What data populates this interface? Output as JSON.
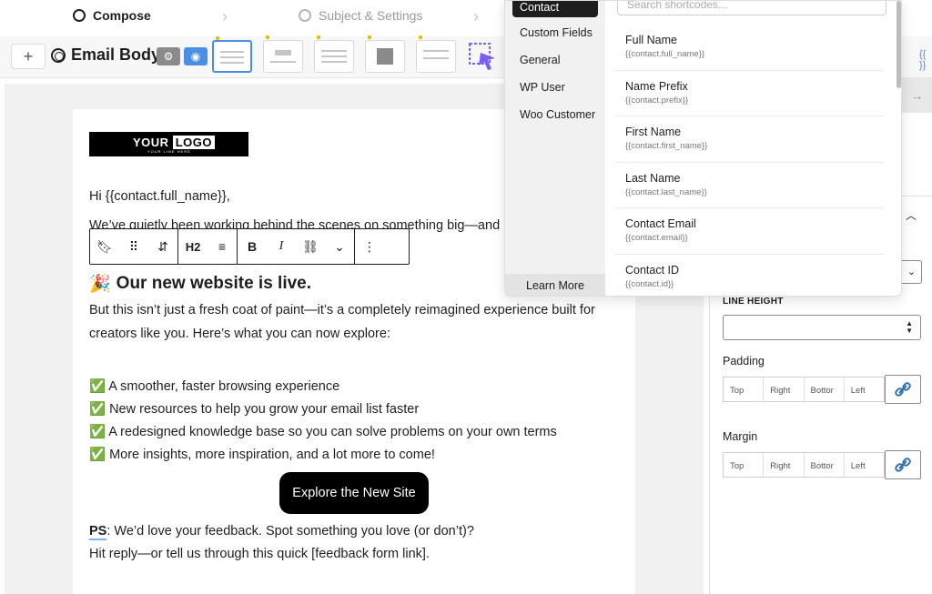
{
  "steps": [
    {
      "label": "Compose",
      "active": true
    },
    {
      "label": "Subject & Settings",
      "active": false
    }
  ],
  "toolbar": {
    "add_label": "+",
    "title": "Email Body"
  },
  "email": {
    "logo_text_1": "YOUR",
    "logo_text_2": "LOGO",
    "logo_tagline": "YOUR LINE HERE",
    "greeting": "Hi {{contact.full_name}},",
    "intro": "We’ve quietly been working behind the scenes on something big—and it",
    "heading_emoji": "🎉",
    "heading": "Our new website is live.",
    "para_1": "But this isn’t just a fresh coat of paint—it’s a completely reimagined experience built for",
    "para_2": "creators like you. Here’s what you can now explore:",
    "bullets": [
      "✅ A smoother, faster browsing experience",
      "✅ New resources to help you grow your email list faster",
      "✅ A redesigned knowledge base so you can solve problems on your own terms",
      "✅ More insights, more inspiration, and a lot more to come!"
    ],
    "cta_label": "Explore the New Site",
    "ps_label": "PS",
    "ps_text": ": We’d love your feedback. Spot something you love (or don’t)?",
    "closing": "Hit reply—or tell us through this quick [feedback form link]."
  },
  "block_toolbar": {
    "heading_level": "H2"
  },
  "sidebar": {
    "line_height_label": "LINE HEIGHT",
    "padding_label": "Padding",
    "margin_label": "Margin",
    "sides": [
      "Top",
      "Right",
      "Bottor",
      "Left"
    ]
  },
  "shortcodes": {
    "search_placeholder": "Search shortcodes...",
    "categories": [
      "Contact",
      "Custom Fields",
      "General",
      "WP User",
      "Woo Customer"
    ],
    "active_category": "Contact",
    "learn_more": "Learn More",
    "items": [
      {
        "name": "Full Name",
        "code": "{{contact.full_name}}"
      },
      {
        "name": "Name Prefix",
        "code": "{{contact.prefix}}"
      },
      {
        "name": "First Name",
        "code": "{{contact.first_name}}"
      },
      {
        "name": "Last Name",
        "code": "{{contact.last_name}}"
      },
      {
        "name": "Contact Email",
        "code": "{{contact.email}}"
      },
      {
        "name": "Contact ID",
        "code": "{{contact.id}}"
      }
    ]
  },
  "colors": {
    "accent": "#4a90e2",
    "cta_bg": "#000000",
    "canvas_bg": "#f1f1f1"
  }
}
